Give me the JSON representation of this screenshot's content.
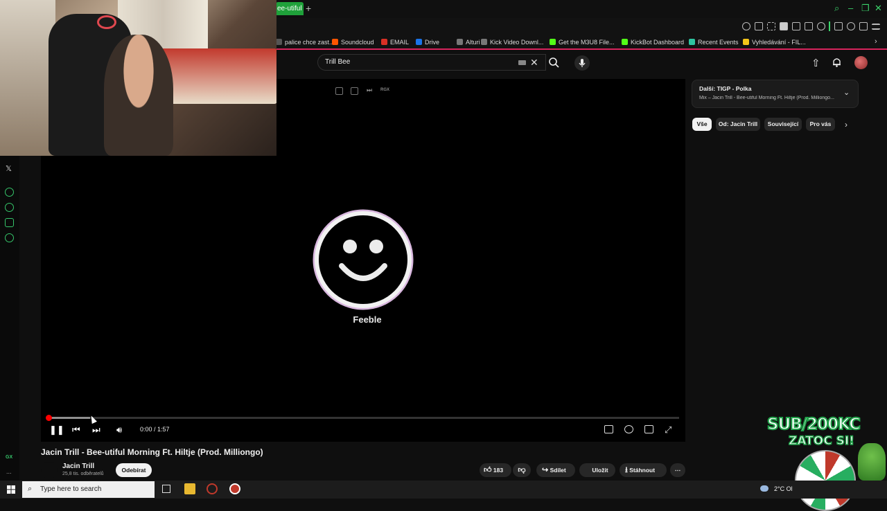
{
  "browser": {
    "active_tab": "ee-utiful",
    "new_tab": "+",
    "bookmarks": [
      {
        "label": "palice chce zast...",
        "color": "#555555"
      },
      {
        "label": "Soundcloud",
        "color": "#ff5500"
      },
      {
        "label": "EMAIL",
        "color": "#d93025"
      },
      {
        "label": "Drive",
        "color": "#1a73e8"
      },
      {
        "label": "Alturi",
        "color": "#777777"
      },
      {
        "label": "Kick Video Downl...",
        "color": "#777777"
      },
      {
        "label": "Get the M3U8 File...",
        "color": "#53fc18"
      },
      {
        "label": "KickBot Dashboard",
        "color": "#53fc18"
      },
      {
        "label": "Recent Events",
        "color": "#2ec4a0"
      },
      {
        "label": "Vyhledávání - FIL...",
        "color": "#f5c518"
      }
    ],
    "accent": "#3bd46b"
  },
  "gx_sidebar": {
    "x_icon": "𝕏",
    "gx_label": "GX",
    "more": "..."
  },
  "header": {
    "search_value": "Trill Bee",
    "clear": "✕"
  },
  "player": {
    "brand": "Feeble",
    "time": "0:00 / 1:57",
    "ext_rgx": "RGX",
    "progress_fraction": 0.0,
    "progress_color": "#ff0000"
  },
  "video": {
    "title": "Jacin Trill - Bee-utiful Morning Ft. Hiltje (Prod. Milliongo)",
    "channel": "Jacin Trill",
    "subscribers": "25,8 tis. odběratelů",
    "subscribe": "Odebírat",
    "likes": "183",
    "share": "Sdílet",
    "save": "Uložit",
    "download": "Stáhnout",
    "more": "⋯"
  },
  "up_next": {
    "label": "Další: TIGP - Polka",
    "subtitle": "Mix – Jacin Trill - Bee-utiful Morning Ft. Hiltje (Prod. Milliongo..."
  },
  "chips": [
    "Vše",
    "Od: Jacin Trill",
    "Související",
    "Pro vás"
  ],
  "overlay": {
    "line1": "SUB/200KC",
    "line2": "ZATOC SI!"
  },
  "taskbar": {
    "search_placeholder": "Type here to search",
    "tray": "2°C  Ol"
  }
}
